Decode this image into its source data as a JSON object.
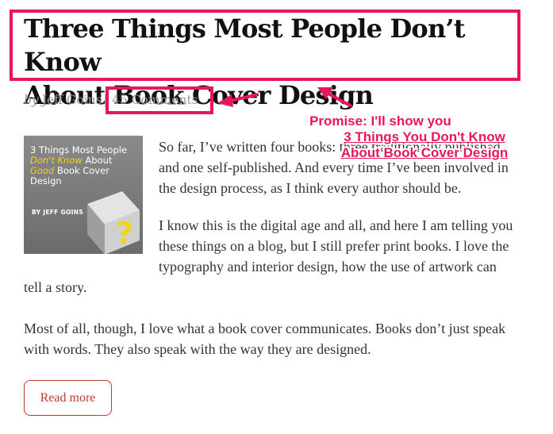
{
  "post": {
    "title_line1": "Three Things Most People Don’t Know",
    "title_line2": "About Book Cover Design",
    "by": "by",
    "author": "Jeff Goins",
    "separator": "|",
    "comments": "45 Comments"
  },
  "thumbnail": {
    "line1": "3 Things Most People",
    "line2_em": "Don't Know",
    "line2_rest": " About",
    "line3_em": "Good",
    "line3_rest": " Book Cover",
    "line4": "Design",
    "author": "BY JEFF GOINS",
    "book_color": "#c9c9c9",
    "question_mark": "?",
    "accent": "#f5d21a"
  },
  "body": {
    "p1_l1": "So far, I’ve written four books: three traditionally published",
    "p1_l2": "and one self-published. And every time I’ve been involved in",
    "p1_l3": "the design process, as I think every author should be.",
    "p2_l1": "I know this is the digital age and all, and here I am telling you",
    "p2_l2": "these things on a blog, but I still prefer print books. I love the",
    "p2_l3": "typography and interior design, how the use of artwork can",
    "p2_l4": "tell a story.",
    "p3_l1": "Most of all, though, I love what a book cover communicates. Books don’t just speak",
    "p3_l2": "with words. They also speak with the way they are designed."
  },
  "read_more": "Read more",
  "annotation": {
    "line1": "Promise: I'll show you",
    "line2": "3 Things You Don't Know",
    "line3": "About Book Cover Design",
    "color": "#e8175d"
  }
}
